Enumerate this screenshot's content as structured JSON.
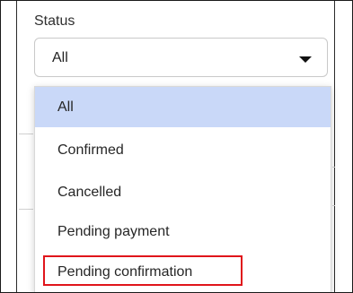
{
  "status_filter": {
    "label": "Status",
    "selected_value": "All",
    "options": [
      {
        "label": "All",
        "selected": true
      },
      {
        "label": "Confirmed",
        "selected": false
      },
      {
        "label": "Cancelled",
        "selected": false
      },
      {
        "label": "Pending payment",
        "selected": false
      },
      {
        "label": "Pending confirmation",
        "selected": false
      }
    ]
  },
  "colors": {
    "selected_option_bg": "#c9d8f8",
    "annotation_highlight": "#e0151b"
  },
  "icons": {
    "dropdown_caret": "caret-down-icon"
  }
}
